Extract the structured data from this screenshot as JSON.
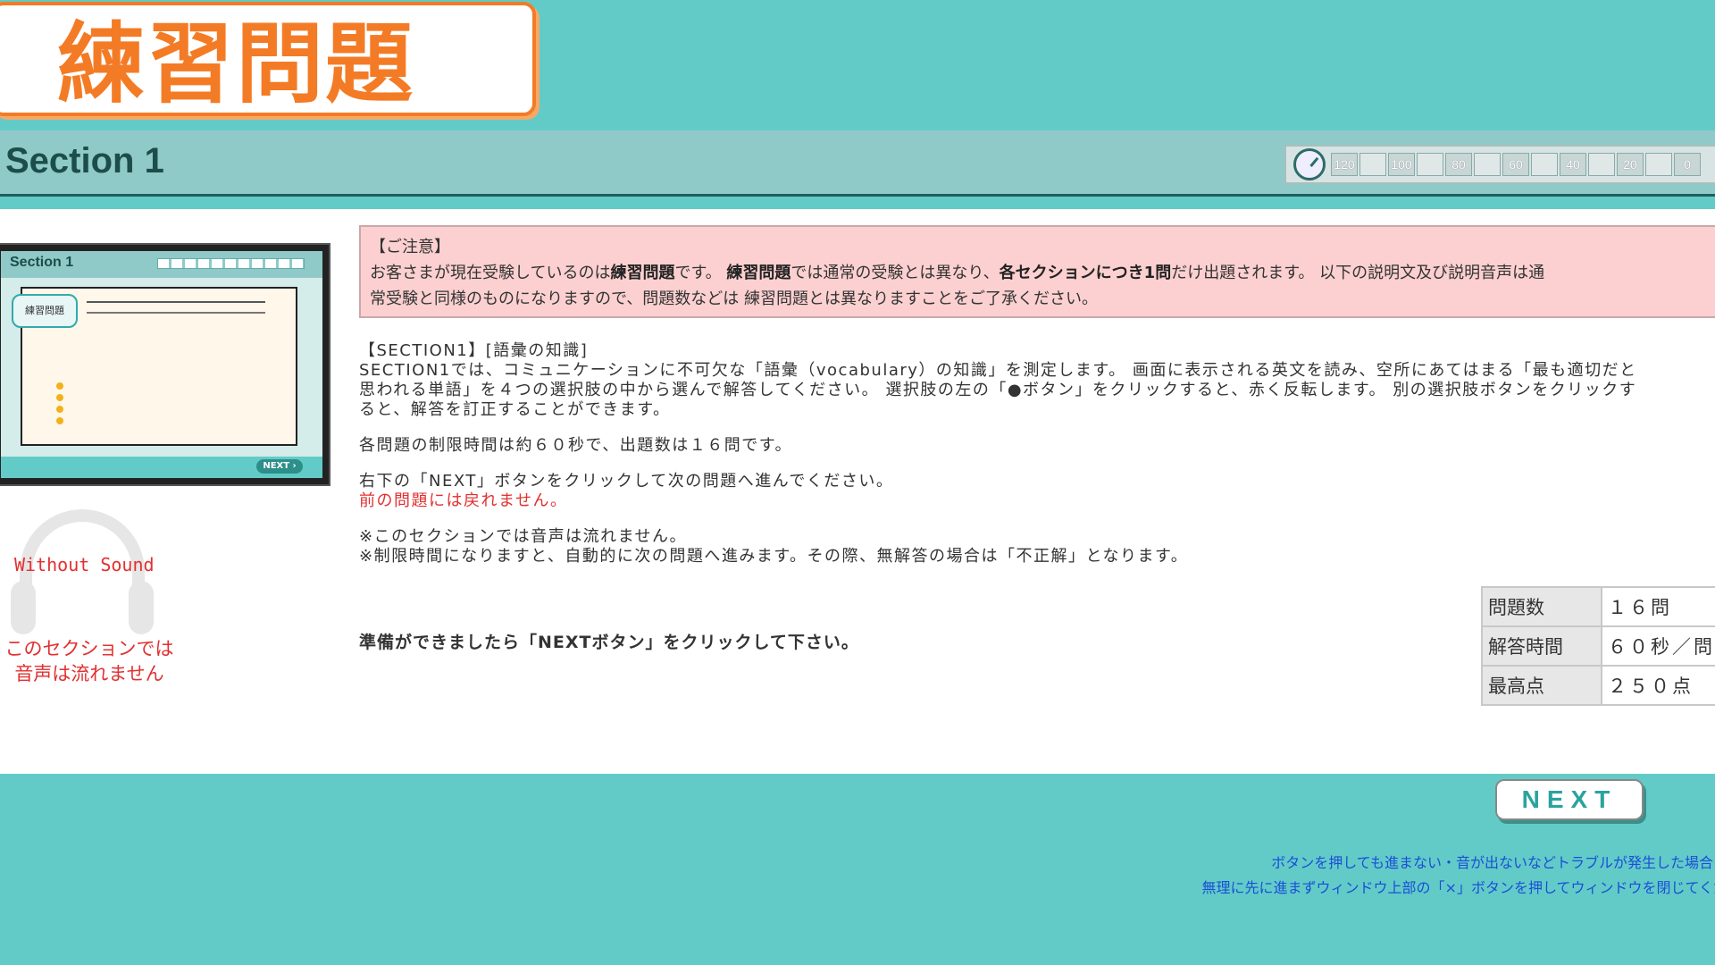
{
  "header": {
    "title": "練習問題"
  },
  "section": {
    "title": "Section 1"
  },
  "timer": {
    "icon": "stopwatch-icon",
    "marks": [
      "120",
      "100",
      "80",
      "60",
      "40",
      "20",
      "0"
    ]
  },
  "preview": {
    "section_label": "Section 1",
    "bubble_label": "練習問題",
    "next_label": "NEXT ›"
  },
  "sound": {
    "icon": "headphones-icon",
    "label": "Without Sound",
    "note_line1": "このセクションでは",
    "note_line2": "音声は流れません"
  },
  "notice": {
    "heading": "【ご注意】",
    "line1_a": "お客さまが現在受験しているのは",
    "line1_b": "練習問題",
    "line1_c": "です。 ",
    "line1_d": "練習問題",
    "line1_e": "では通常の受験とは異なり、",
    "line1_f": "各セクションにつき1問",
    "line1_g": "だけ出題されます。 以下の説明文及び説明音声は通",
    "line2": "常受験と同様のものになりますので、問題数などは 練習問題とは異なりますことをご了承ください。"
  },
  "instructions": {
    "heading": "【SECTION1】[語彙の知識]",
    "para1_line1": "SECTION1では、コミュニケーションに不可欠な「語彙（vocabulary）の知識」を測定します。 画面に表示される英文を読み、空所にあてはまる「最も適切だと",
    "para1_line2": "思われる単語」を４つの選択肢の中から選んで解答してください。 選択肢の左の「●ボタン」をクリックすると、赤く反転します。 別の選択肢ボタンをクリックす",
    "para1_line3": "ると、解答を訂正することができます。",
    "para2": "各問題の制限時間は約６０秒で、出題数は１６問です。",
    "para3_line1": "右下の「NEXT」ボタンをクリックして次の問題へ進んでください。",
    "para3_line2": "前の問題には戻れません。",
    "note1": "※このセクションでは音声は流れません。",
    "note2": "※制限時間になりますと、自動的に次の問題へ進みます。その際、無解答の場合は「不正解」となります。",
    "ready": "準備ができましたら「NEXTボタン」をクリックして下さい。"
  },
  "info_table": {
    "rows": [
      {
        "key": "問題数",
        "value": "１６問"
      },
      {
        "key": "解答時間",
        "value": "６０秒／問"
      },
      {
        "key": "最高点",
        "value": "２５０点"
      }
    ]
  },
  "footer": {
    "next_label": "NEXT",
    "trouble_line1": "ボタンを押しても進まない・音が出ないなどトラブルが発生した場合には",
    "trouble_line2": "無理に先に進まずウィンドウ上部の「×」ボタンを押してウィンドウを閉じてくださ"
  },
  "colors": {
    "teal": "#62cbc8",
    "orange": "#f47b25",
    "notice_pink": "#fcd0d0",
    "alert_red": "#e23030",
    "link_blue": "#1a4fd6"
  }
}
